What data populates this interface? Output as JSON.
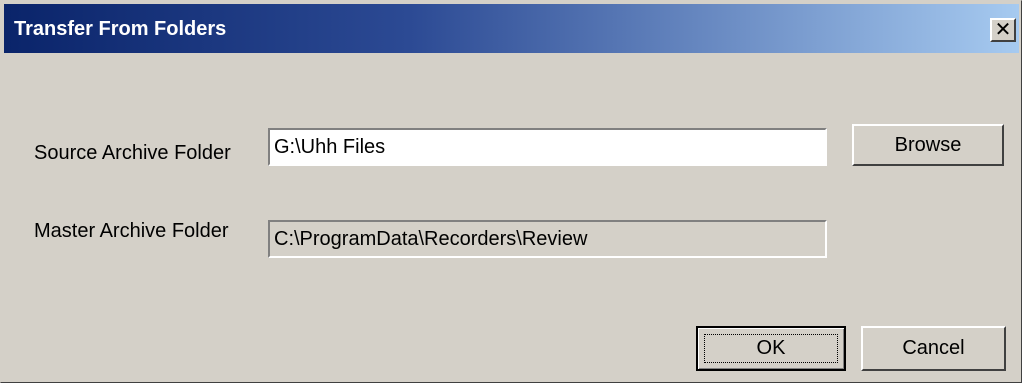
{
  "window": {
    "title": "Transfer From Folders",
    "close_glyph": "✕",
    "close_icon": "close-icon"
  },
  "source": {
    "label": "Source Archive Folder",
    "value": "G:\\Uhh Files",
    "browse_label": "Browse"
  },
  "master": {
    "label": "Master Archive Folder",
    "value": "C:\\ProgramData\\Recorders\\Review"
  },
  "buttons": {
    "ok_label": "OK",
    "cancel_label": "Cancel"
  },
  "colors": {
    "titlebar_start": "#0a246a",
    "titlebar_end": "#a6caf0",
    "face": "#d4d0c8"
  }
}
